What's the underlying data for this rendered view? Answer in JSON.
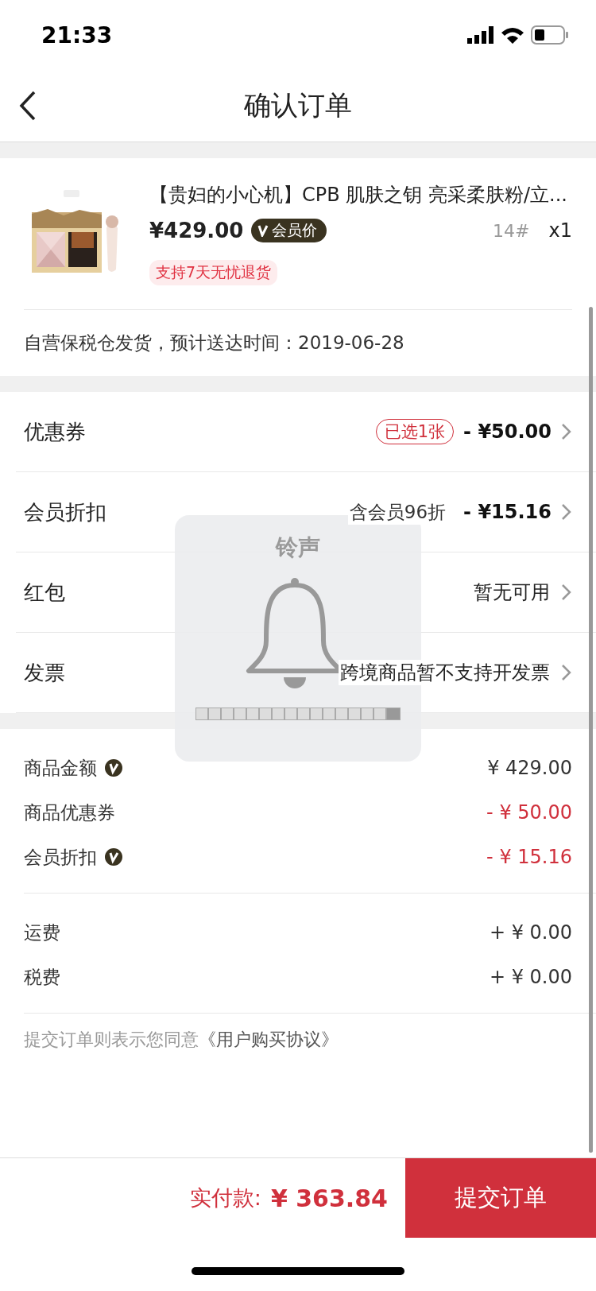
{
  "status_bar": {
    "time": "21:33"
  },
  "nav": {
    "title": "确认订单"
  },
  "product": {
    "kind": "picture",
    "title": "【贵妇的小心机】CPB 肌肤之钥 亮采柔肤粉/立...",
    "price": "¥429.00",
    "member_badge": "会员价",
    "spec": "14#",
    "quantity": "x1",
    "return_tag": "支持7天无忧退货"
  },
  "shipping_note": "自营保税仓发货，预计送达时间：2019-06-28",
  "options": [
    {
      "label": "优惠券",
      "tag": "已选1张",
      "value": "- ¥50.00",
      "kind": "amount"
    },
    {
      "label": "会员折扣",
      "note": "含会员96折",
      "value": "- ¥15.16",
      "kind": "amount"
    },
    {
      "label": "红包",
      "value": "暂无可用",
      "kind": "text"
    },
    {
      "label": "发票",
      "value": "跨境商品暂不支持开发票",
      "kind": "text"
    }
  ],
  "summary": [
    [
      {
        "label": "商品金额",
        "vip": true,
        "value": "¥ 429.00",
        "kind": "charge"
      },
      {
        "label": "商品优惠券",
        "vip": false,
        "value": "- ¥ 50.00",
        "kind": "discount"
      },
      {
        "label": "会员折扣",
        "vip": true,
        "value": "- ¥ 15.16",
        "kind": "discount"
      }
    ],
    [
      {
        "label": "运费",
        "vip": false,
        "value": "+ ¥ 0.00",
        "kind": "charge"
      },
      {
        "label": "税费",
        "vip": false,
        "value": "+ ¥ 0.00",
        "kind": "charge"
      }
    ]
  ],
  "agreement": {
    "text": "提交订单则表示您同意",
    "link": "《用户购买协议》"
  },
  "footer": {
    "total_label": "实付款:",
    "total": "¥ 363.84",
    "submit": "提交订单"
  },
  "ringer_hud": {
    "title": "铃声",
    "level": 0.9375
  }
}
